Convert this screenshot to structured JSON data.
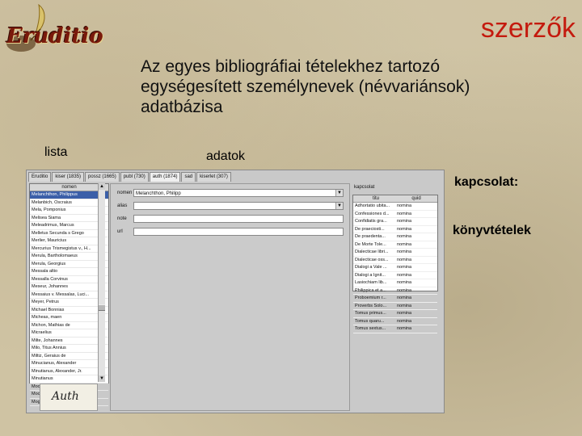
{
  "slide": {
    "title": "szerzők",
    "subtitle": "Az egyes bibliográfiai tételekhez tartozó egységesített személynevek (névvariánsok) adatbázisa",
    "logo_text": "Eruditio",
    "labels": {
      "lista": "lista",
      "adatok": "adatok",
      "kapcsolat": "kapcsolat:",
      "konyvtetelek": "könyvtételek"
    }
  },
  "app": {
    "tabs": [
      "Eruditio",
      "kiser (1835)",
      "possz (1665)",
      "publ (730)",
      "auth (1874)",
      "sad",
      "kiserlet (307)"
    ],
    "active_tab": 4,
    "list": {
      "header": "nomen",
      "items": [
        "Melanchthon, Philippus",
        "Melanbich, Oscraius",
        "Mela, Pomponius",
        "Melisea Siama",
        "Meleadrimus, Marcus",
        "Melletus Secunda s Grego",
        "Merlier, Mauricius",
        "Mercurius Trismegistus v., H...",
        "Merula, Bartholomaeus",
        "Merula, Georgius",
        "Messala altio",
        "Messalla Corvinus",
        "Meseur, Johannes",
        "Messaius v. Messalas, Luci...",
        "Meyer, Petrus",
        "Michael Bonnias",
        "Micheas, maen",
        "Michon, Mathias de",
        "Micraelius",
        "Milte, Johannes",
        "Milo, Titus Annius",
        "Miltiz, Geraius de",
        "Minucianus, Alexander",
        "Minutianus, Alexander, Jr.",
        "Minutianus",
        "Mocenicus, Petrus",
        "Mocenius, Julius",
        "Mogance"
      ],
      "selected_index": 0
    },
    "auth_logo": "Auth",
    "form": {
      "nomen_label": "nomen",
      "nomen_value": "Melanchthon, Philipp",
      "alias_label": "alias",
      "alias_value": "",
      "note_label": "note",
      "note_value": "",
      "url_label": "url",
      "url_value": ""
    },
    "relation": {
      "label": "kapcsolat",
      "col_titulus": "titu",
      "col_quid": "quid",
      "rows": [
        [
          "Adhortatio ubita...",
          "nomina"
        ],
        [
          "Confessiones d...",
          "nomina"
        ],
        [
          "Confidiatis gra...",
          "nomina"
        ],
        [
          "De praeciosti...",
          "nomina"
        ],
        [
          "De praedenta...",
          "nomina"
        ],
        [
          "De Morte Tole...",
          "nomina"
        ],
        [
          "Dialecticae libri...",
          "nomina"
        ],
        [
          "Dialecticae oss...",
          "nomina"
        ],
        [
          "Dialogi a Vale ...",
          "nomina"
        ],
        [
          "Dialogi a Ignit...",
          "nomina"
        ],
        [
          "Lasiochiam lib...",
          "nomina"
        ],
        [
          "Philippica et a...",
          "nomina"
        ],
        [
          "Proboemium r...",
          "nomina"
        ],
        [
          "Proverbs Solo...",
          "nomina"
        ],
        [
          "Tomus primus...",
          "nomina"
        ],
        [
          "Tomus quaru...",
          "nomina"
        ],
        [
          "Tomus sextus...",
          "nomina"
        ]
      ]
    }
  }
}
